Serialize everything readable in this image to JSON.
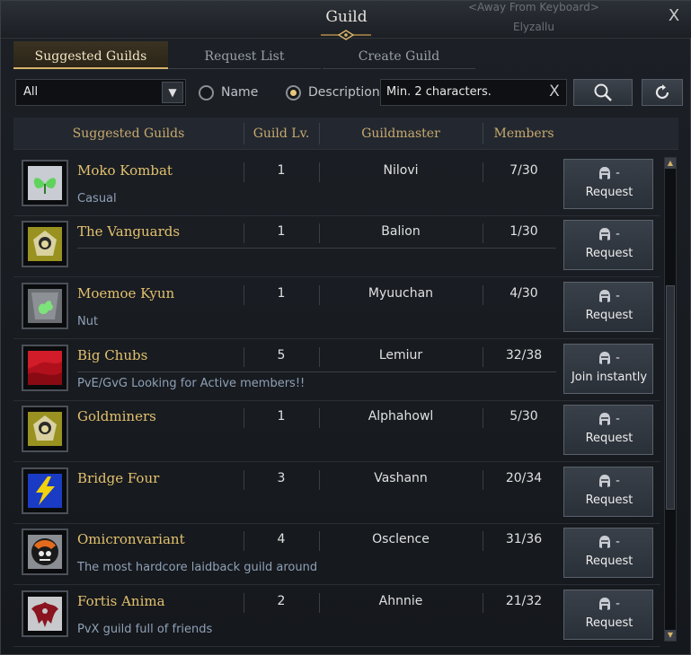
{
  "window": {
    "title": "Guild",
    "background_text_1": "<Away From Keyboard>",
    "background_text_2": "Elyzallu",
    "close_glyph": "X"
  },
  "tabs": [
    {
      "label": "Suggested Guilds",
      "active": true
    },
    {
      "label": "Request List",
      "active": false
    },
    {
      "label": "Create Guild",
      "active": false
    }
  ],
  "filters": {
    "type_select_value": "All",
    "radio_name_label": "Name",
    "radio_description_label": "Description",
    "selected_radio": "Description",
    "search_value": "Min. 2 characters.",
    "clear_glyph": "X"
  },
  "columns": {
    "name": "Suggested Guilds",
    "level": "Guild Lv.",
    "master": "Guildmaster",
    "members": "Members"
  },
  "guilds": [
    {
      "name": "Moko Kombat",
      "level": "1",
      "master": "Nilovi",
      "members": "7/30",
      "description": "Casual",
      "action": "Request",
      "action_top": "-",
      "emblem": "green-butterfly-emblem"
    },
    {
      "name": "The Vanguards",
      "level": "1",
      "master": "Balion",
      "members": "1/30",
      "description": "",
      "action": "Request",
      "action_top": "-",
      "emblem": "lion-emblem"
    },
    {
      "name": "Moemoe Kyun",
      "level": "1",
      "master": "Myuuchan",
      "members": "4/30",
      "description": "Nut",
      "action": "Request",
      "action_top": "-",
      "emblem": "green-creature-emblem"
    },
    {
      "name": "Big Chubs",
      "level": "5",
      "master": "Lemiur",
      "members": "32/38",
      "description": "PvE/GvG Looking for Active members!!",
      "action": "Join instantly",
      "action_top": "-",
      "emblem": "red-banner-emblem"
    },
    {
      "name": "Goldminers",
      "level": "1",
      "master": "Alphahowl",
      "members": "5/30",
      "description": "",
      "action": "Request",
      "action_top": "-",
      "emblem": "lion-emblem"
    },
    {
      "name": "Bridge Four",
      "level": "3",
      "master": "Vashann",
      "members": "20/34",
      "description": "",
      "action": "Request",
      "action_top": "-",
      "emblem": "yellow-lightning-emblem"
    },
    {
      "name": "Omicronvariant",
      "level": "4",
      "master": "Osclence",
      "members": "31/36",
      "description": "The most hardcore laidback guild around",
      "action": "Request",
      "action_top": "-",
      "emblem": "orange-skull-emblem"
    },
    {
      "name": "Fortis Anima",
      "level": "2",
      "master": "Ahnnie",
      "members": "21/32",
      "description": "PvX guild full of friends",
      "action": "Request",
      "action_top": "-",
      "emblem": "red-demon-emblem"
    }
  ],
  "colors": {
    "accent_gold": "#e3c16e",
    "header_gold": "#c8aa6e",
    "description_blue": "#8fa0b6"
  }
}
